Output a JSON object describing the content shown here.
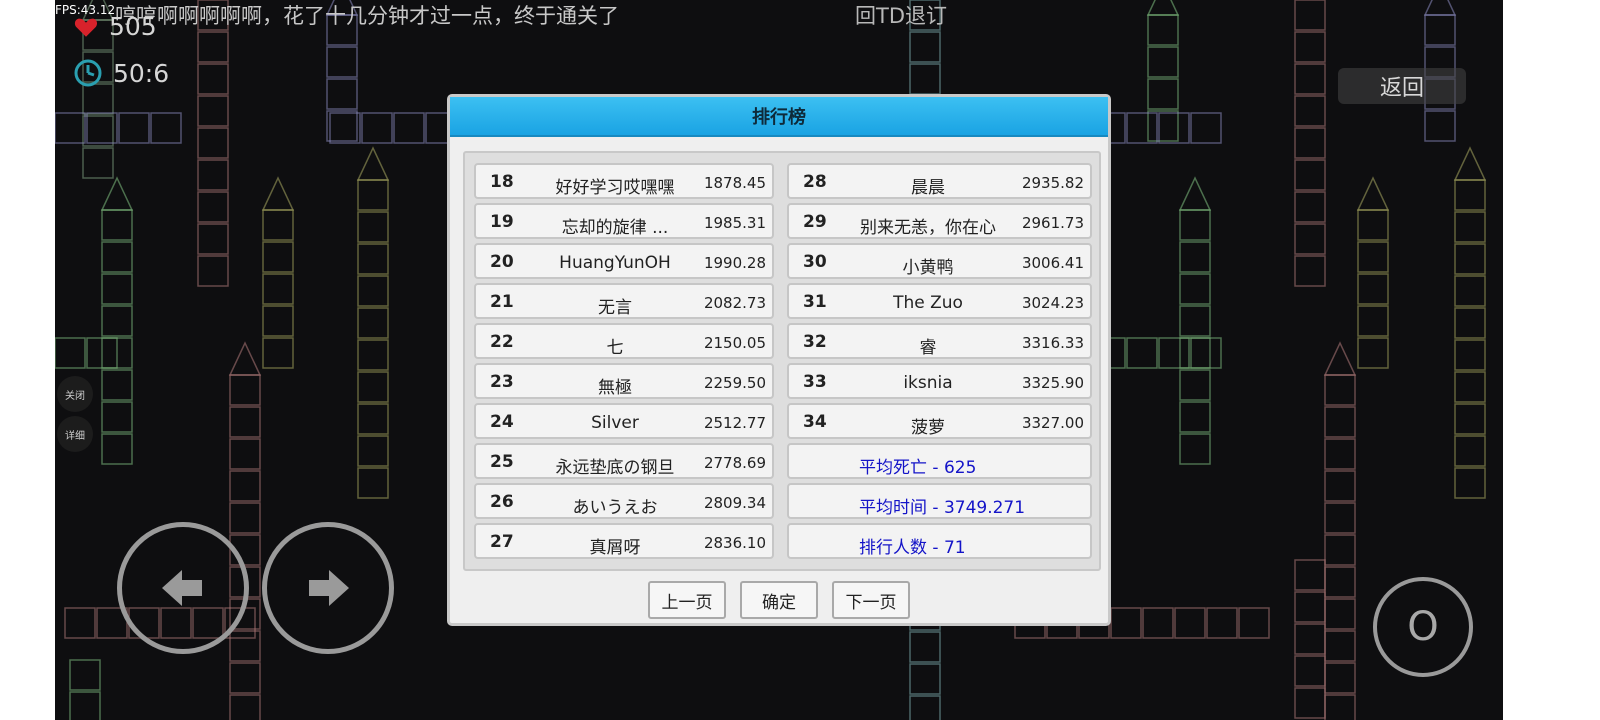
{
  "hud": {
    "fps": "FPS:43.12",
    "marquee": "哼哼啊啊啊啊啊，花了十几分钟才过一点，终于通关了",
    "top_right_text": "回TD退订",
    "deaths": "505",
    "time": "50:6",
    "back_label": "返回",
    "close_label": "关闭",
    "detail_label": "详细",
    "jump_label": "O"
  },
  "dialog": {
    "title": "排行榜",
    "left_rows": [
      {
        "rank": "18",
        "name": "好好学习哎嘿嘿",
        "score": "1878.45"
      },
      {
        "rank": "19",
        "name": "忘却的旋律 ...",
        "score": "1985.31"
      },
      {
        "rank": "20",
        "name": "HuangYunOH",
        "score": "1990.28"
      },
      {
        "rank": "21",
        "name": "无言",
        "score": "2082.73"
      },
      {
        "rank": "22",
        "name": "七",
        "score": "2150.05"
      },
      {
        "rank": "23",
        "name": "無極",
        "score": "2259.50"
      },
      {
        "rank": "24",
        "name": "Silver",
        "score": "2512.77"
      },
      {
        "rank": "25",
        "name": "永远垫底の钢旦",
        "score": "2778.69"
      },
      {
        "rank": "26",
        "name": "あいうえお",
        "score": "2809.34"
      },
      {
        "rank": "27",
        "name": "真屑呀",
        "score": "2836.10"
      }
    ],
    "right_rows": [
      {
        "rank": "28",
        "name": "晨晨",
        "score": "2935.82"
      },
      {
        "rank": "29",
        "name": "别来无恙，你在心",
        "score": "2961.73"
      },
      {
        "rank": "30",
        "name": "小黄鸭",
        "score": "3006.41"
      },
      {
        "rank": "31",
        "name": "The Zuo",
        "score": "3024.23"
      },
      {
        "rank": "32",
        "name": "睿",
        "score": "3316.33"
      },
      {
        "rank": "33",
        "name": "iksnia",
        "score": "3325.90"
      },
      {
        "rank": "34",
        "name": "菠萝",
        "score": "3327.00"
      }
    ],
    "stats": {
      "avg_deaths": "平均死亡 - 625",
      "avg_time": "平均时间 - 3749.271",
      "player_count": "排行人数 - 71"
    },
    "buttons": {
      "prev": "上一页",
      "confirm": "确定",
      "next": "下一页"
    }
  },
  "colors": {
    "header_blue": "#1aa3e3",
    "stat_text": "#1414c8",
    "background": "#0e0e10"
  }
}
